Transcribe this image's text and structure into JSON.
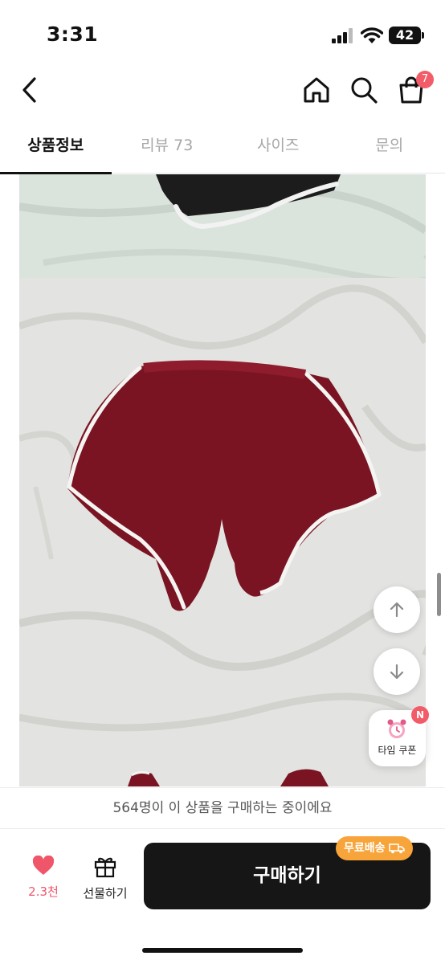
{
  "status_bar": {
    "time": "3:31",
    "battery": "42"
  },
  "nav": {
    "cart_count": "7"
  },
  "tabs": [
    {
      "label": "상품정보"
    },
    {
      "label": "리뷰 73"
    },
    {
      "label": "사이즈"
    },
    {
      "label": "문의"
    }
  ],
  "floating": {
    "coupon_label": "타임 쿠폰",
    "coupon_badge": "N"
  },
  "notice": "564명이 이 상품을 구매하는 중이에요",
  "bottom_bar": {
    "like_count": "2.3천",
    "gift_label": "선물하기",
    "buy_label": "구매하기",
    "shipping_badge": "무료배송"
  },
  "colors": {
    "accent_red": "#f25c68",
    "shipping_orange": "#f7a43a",
    "buy_button": "#161616",
    "product_burgundy": "#7a1422"
  },
  "icons": [
    "back-icon",
    "home-icon",
    "search-icon",
    "cart-icon",
    "arrow-up-icon",
    "arrow-down-icon",
    "alarm-clock-icon",
    "heart-icon",
    "gift-icon",
    "truck-icon"
  ]
}
